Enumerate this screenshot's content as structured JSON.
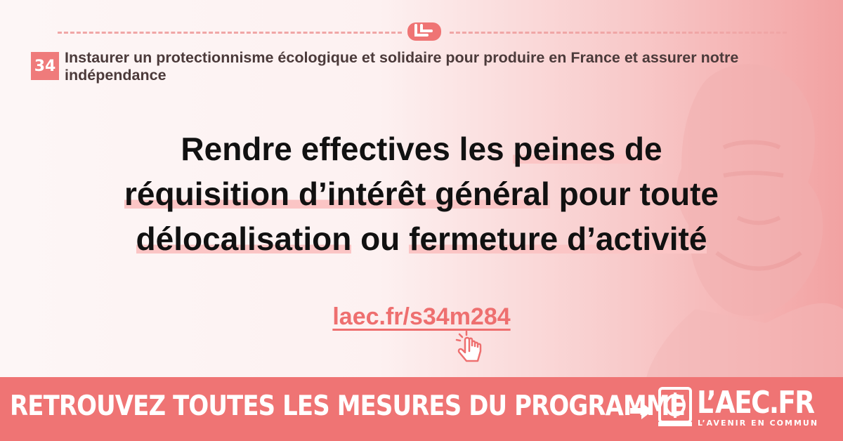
{
  "chapter": {
    "number": "34",
    "title": "Instaurer un protectionnisme écologique et solidaire pour produire en France et assurer notre indépendance"
  },
  "measure": {
    "line1_plain": "Rendre effectives les ",
    "line1_hl": "peines de",
    "line2_hl": "réquisition d’intérêt général",
    "line2_plain": " pour toute",
    "line3_hl1": "délocalisation",
    "line3_mid": " ou ",
    "line3_hl2": "fermeture d’activité"
  },
  "link": {
    "text": "laec.fr/s34m284"
  },
  "footer": {
    "cta": "RETROUVEZ TOUTES LES MESURES DU PROGRAMME",
    "logo_text": "L’AEC.FR",
    "logo_tagline": "L’AVENIR EN COMMUN"
  },
  "icons": {
    "hands": "handshake-icon",
    "cursor": "pointer-hand-icon",
    "arrow": "arrow-right-icon",
    "logo": "phi-logo-icon"
  },
  "colors": {
    "accent": "#ef7474",
    "highlight": "#fbc5c5",
    "text": "#111111"
  }
}
